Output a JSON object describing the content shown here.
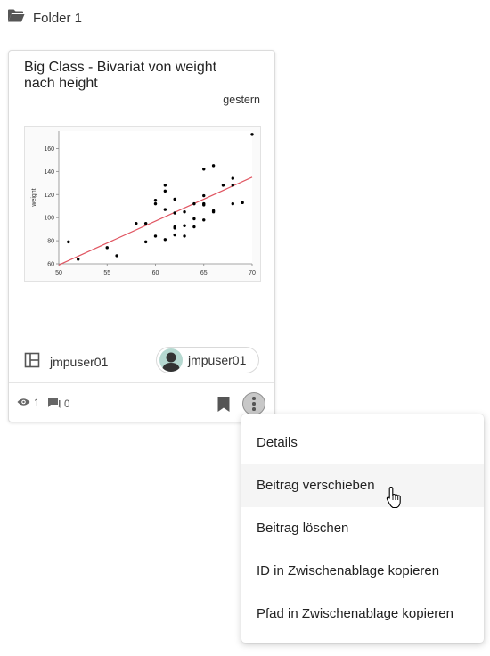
{
  "folder": {
    "icon": "folder-open-icon",
    "name": "Folder 1"
  },
  "card": {
    "title": "Big Class - Bivariat von weight nach height",
    "date": "gestern",
    "owner_icon": "dashboard-layout-icon",
    "owner": "jmpuser01",
    "author_chip": "jmpuser01",
    "views": "1",
    "comments": "0"
  },
  "chart_data": {
    "type": "scatter",
    "xlabel": "",
    "ylabel": "weight",
    "xlim": [
      50,
      70
    ],
    "ylim": [
      60,
      175
    ],
    "xticks": [
      "50",
      "55",
      "60",
      "65",
      "70"
    ],
    "yticks": [
      "60",
      "80",
      "100",
      "120",
      "140",
      "160"
    ],
    "points": [
      [
        51,
        79
      ],
      [
        52,
        64
      ],
      [
        55,
        74
      ],
      [
        56,
        67
      ],
      [
        58,
        95
      ],
      [
        59,
        79
      ],
      [
        59,
        95
      ],
      [
        60,
        84
      ],
      [
        60,
        112
      ],
      [
        60,
        115
      ],
      [
        61,
        81
      ],
      [
        61,
        107
      ],
      [
        61,
        123
      ],
      [
        61,
        128
      ],
      [
        62,
        85
      ],
      [
        62,
        91
      ],
      [
        62,
        92
      ],
      [
        62,
        104
      ],
      [
        62,
        116
      ],
      [
        63,
        84
      ],
      [
        63,
        93
      ],
      [
        63,
        105
      ],
      [
        64,
        92
      ],
      [
        64,
        99
      ],
      [
        64,
        112
      ],
      [
        65,
        98
      ],
      [
        65,
        111
      ],
      [
        65,
        112
      ],
      [
        65,
        119
      ],
      [
        65,
        142
      ],
      [
        66,
        105
      ],
      [
        66,
        106
      ],
      [
        66,
        145
      ],
      [
        67,
        128
      ],
      [
        68,
        112
      ],
      [
        68,
        128
      ],
      [
        68,
        134
      ],
      [
        69,
        113
      ],
      [
        70,
        172
      ]
    ],
    "fit_line": {
      "x": [
        50,
        71
      ],
      "y": [
        59,
        135
      ],
      "color": "#e05561"
    },
    "point_color": "#000000",
    "grid": false
  },
  "menu": {
    "items": [
      "Details",
      "Beitrag verschieben",
      "Beitrag löschen",
      "ID in Zwischenablage kopieren",
      "Pfad in Zwischenablage kopieren"
    ],
    "hovered_index": 1
  }
}
